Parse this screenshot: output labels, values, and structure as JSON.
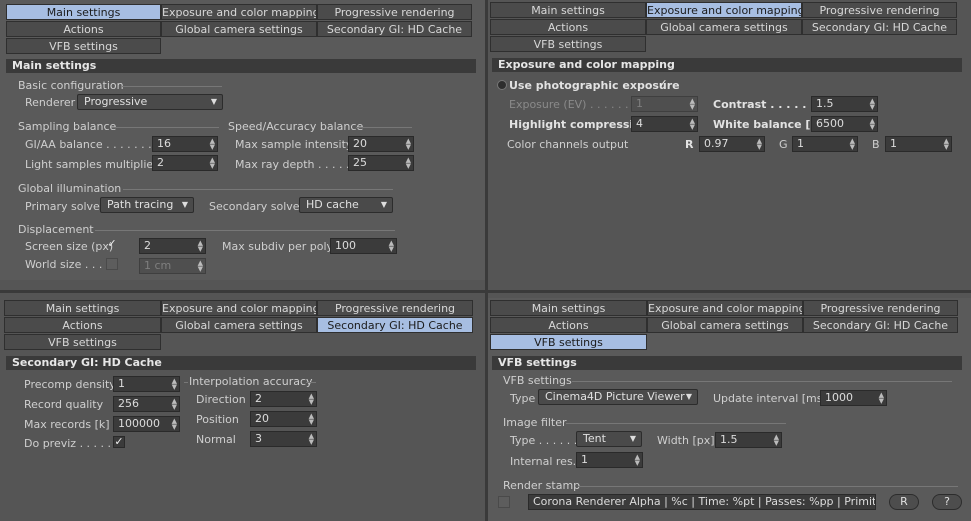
{
  "tabs": {
    "main": "Main settings",
    "exposure": "Exposure and color mapping",
    "progressive": "Progressive rendering",
    "actions": "Actions",
    "camera": "Global camera settings",
    "secondary_gi": "Secondary GI: HD Cache",
    "vfb": "VFB settings"
  },
  "main": {
    "title": "Main settings",
    "basic_config": "Basic configuration",
    "renderer_label": "Renderer",
    "renderer_value": "Progressive",
    "sampling_balance": "Sampling balance",
    "gi_aa_label": "GI/AA balance . . . . . . . .",
    "gi_aa_value": "16",
    "light_samples_label": "Light samples multiplier",
    "light_samples_value": "2",
    "speed_accuracy": "Speed/Accuracy balance",
    "max_sample_label": "Max sample intensity",
    "max_sample_value": "20",
    "max_ray_label": "Max ray depth . . . . . .",
    "max_ray_value": "25",
    "global_illumination": "Global illumination",
    "primary_label": "Primary solver",
    "primary_value": "Path tracing",
    "secondary_label": "Secondary solver",
    "secondary_value": "HD cache",
    "displacement": "Displacement",
    "screen_size_label": "Screen size (px)",
    "screen_size_value": "2",
    "world_size_label": "World size . . . .",
    "world_size_value": "1 cm",
    "max_subdiv_label": "Max subdiv per poly",
    "max_subdiv_value": "100"
  },
  "exposure": {
    "title": "Exposure and color mapping",
    "use_photo_label": "Use photographic exposure",
    "exposure_label": "Exposure (EV) . . . . . . .",
    "exposure_value": "1",
    "contrast_label": "Contrast . . . . . . . . .",
    "contrast_value": "1.5",
    "highlight_label": "Highlight compression",
    "highlight_value": "4",
    "white_balance_label": "White balance [K]",
    "white_balance_value": "6500",
    "color_channels_label": "Color channels output",
    "r_label": "R",
    "r_value": "0.97",
    "g_label": "G",
    "g_value": "1",
    "b_label": "B",
    "b_value": "1"
  },
  "hdcache": {
    "title": "Secondary GI: HD Cache",
    "precomp_label": "Precomp density",
    "precomp_value": "1",
    "record_quality_label": "Record quality",
    "record_quality_value": "256",
    "max_records_label": "Max records [k]",
    "max_records_value": "100000",
    "do_previz_label": "Do previz . . . . . . .",
    "interp_accuracy": "Interpolation accuracy",
    "direction_label": "Direction",
    "direction_value": "2",
    "position_label": "Position",
    "position_value": "20",
    "normal_label": "Normal",
    "normal_value": "3"
  },
  "vfb": {
    "title": "VFB settings",
    "group": "VFB settings",
    "type_label": "Type",
    "type_value": "Cinema4D Picture Viewer",
    "update_label": "Update interval [ms]",
    "update_value": "1000",
    "image_filter": "Image filter",
    "filter_type_label": "Type . . . . . .",
    "filter_type_value": "Tent",
    "width_label": "Width [px]",
    "width_value": "1.5",
    "internal_res_label": "Internal res.",
    "internal_res_value": "1",
    "render_stamp": "Render stamp",
    "stamp_value": "Corona Renderer Alpha | %c | Time: %pt | Passes: %pp | Primitives: %",
    "r_button": "R",
    "help_button": "?"
  },
  "icons": {
    "check": "✓",
    "dropdown": "dropdown-arrow-icon",
    "spinner": "spinner-arrows-icon"
  },
  "colors": {
    "active_tab": "#a7bee2",
    "section_bar": "#3a3a3a",
    "panel": "#5a5a5a"
  }
}
